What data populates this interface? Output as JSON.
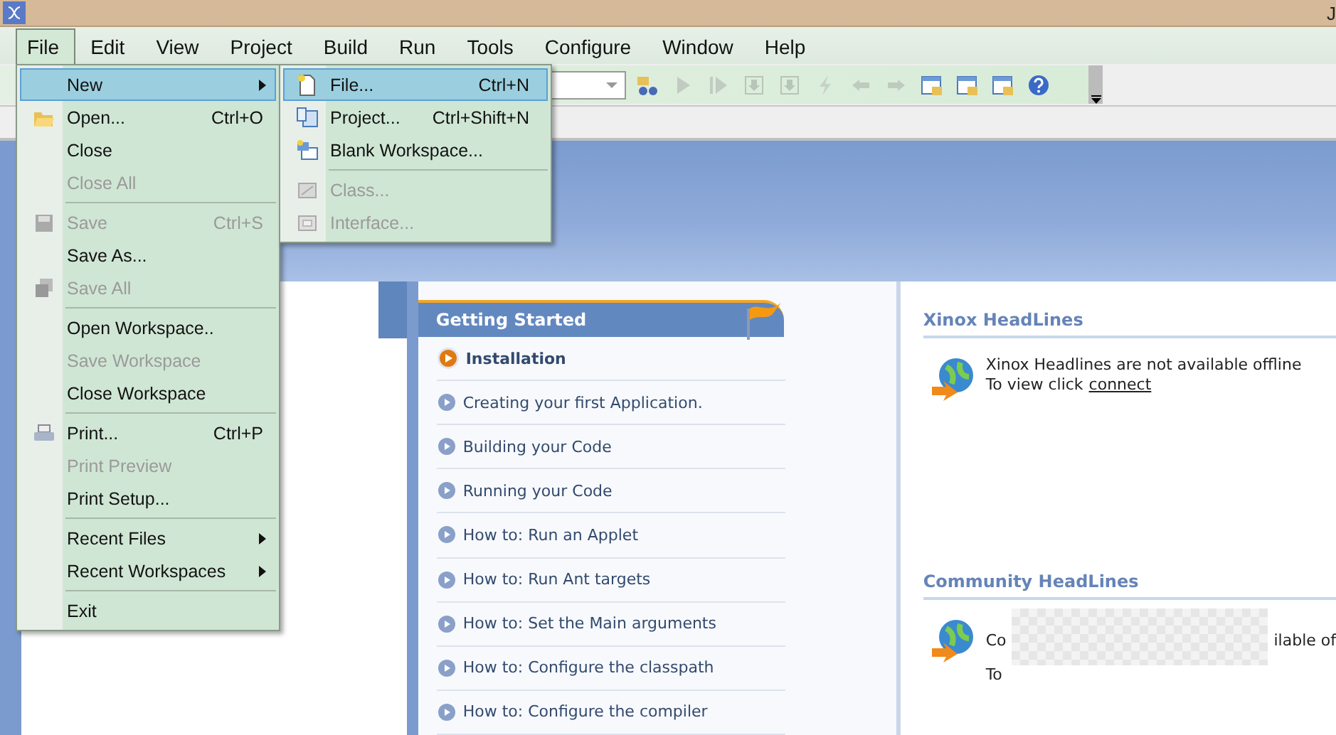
{
  "window": {
    "title": "J"
  },
  "menubar": [
    {
      "label": "File",
      "selected": true
    },
    {
      "label": "Edit",
      "selected": false
    },
    {
      "label": "View",
      "selected": false
    },
    {
      "label": "Project",
      "selected": false
    },
    {
      "label": "Build",
      "selected": false
    },
    {
      "label": "Run",
      "selected": false
    },
    {
      "label": "Tools",
      "selected": false
    },
    {
      "label": "Configure",
      "selected": false
    },
    {
      "label": "Window",
      "selected": false
    },
    {
      "label": "Help",
      "selected": false
    }
  ],
  "toolbar": [
    {
      "kind": "find",
      "disabled": false
    },
    {
      "kind": "run",
      "disabled": true
    },
    {
      "kind": "step",
      "disabled": true
    },
    {
      "kind": "down",
      "disabled": true
    },
    {
      "kind": "down",
      "disabled": true
    },
    {
      "kind": "bolt",
      "disabled": true
    },
    {
      "kind": "back",
      "disabled": true
    },
    {
      "kind": "forward",
      "disabled": true
    },
    {
      "kind": "window",
      "disabled": false
    },
    {
      "kind": "window",
      "disabled": false
    },
    {
      "kind": "window",
      "disabled": false
    },
    {
      "kind": "help",
      "disabled": false
    }
  ],
  "file_menu": [
    {
      "kind": "item",
      "label": "New",
      "disabled": false,
      "selected": true,
      "submenu": true
    },
    {
      "kind": "item",
      "label": "Open...",
      "shortcut": "Ctrl+O",
      "disabled": false,
      "selected": false,
      "submenu": false
    },
    {
      "kind": "item",
      "label": "Close",
      "disabled": false,
      "selected": false,
      "submenu": false
    },
    {
      "kind": "item",
      "label": "Close All",
      "disabled": true,
      "selected": false,
      "submenu": false
    },
    {
      "kind": "separator"
    },
    {
      "kind": "item",
      "label": "Save",
      "shortcut": "Ctrl+S",
      "disabled": true,
      "selected": false,
      "submenu": false
    },
    {
      "kind": "item",
      "label": "Save As...",
      "disabled": false,
      "selected": false,
      "submenu": false
    },
    {
      "kind": "item",
      "label": "Save All",
      "disabled": true,
      "selected": false,
      "submenu": false
    },
    {
      "kind": "separator"
    },
    {
      "kind": "item",
      "label": "Open Workspace..",
      "disabled": false,
      "selected": false,
      "submenu": false
    },
    {
      "kind": "item",
      "label": "Save Workspace",
      "disabled": true,
      "selected": false,
      "submenu": false
    },
    {
      "kind": "item",
      "label": "Close Workspace",
      "disabled": false,
      "selected": false,
      "submenu": false
    },
    {
      "kind": "separator"
    },
    {
      "kind": "item",
      "label": "Print...",
      "shortcut": "Ctrl+P",
      "disabled": false,
      "selected": false,
      "submenu": false
    },
    {
      "kind": "item",
      "label": "Print Preview",
      "disabled": true,
      "selected": false,
      "submenu": false
    },
    {
      "kind": "item",
      "label": "Print Setup...",
      "disabled": false,
      "selected": false,
      "submenu": false
    },
    {
      "kind": "separator"
    },
    {
      "kind": "item",
      "label": "Recent Files",
      "disabled": false,
      "selected": false,
      "submenu": true
    },
    {
      "kind": "item",
      "label": "Recent Workspaces",
      "disabled": false,
      "selected": false,
      "submenu": true
    },
    {
      "kind": "separator"
    },
    {
      "kind": "item",
      "label": "Exit",
      "disabled": false,
      "selected": false,
      "submenu": false
    }
  ],
  "new_submenu": [
    {
      "kind": "item",
      "label": "File...",
      "shortcut": "Ctrl+N",
      "disabled": false,
      "selected": true
    },
    {
      "kind": "item",
      "label": "Project...",
      "shortcut": "Ctrl+Shift+N",
      "disabled": false,
      "selected": false
    },
    {
      "kind": "item",
      "label": "Blank Workspace...",
      "disabled": false,
      "selected": false
    },
    {
      "kind": "separator"
    },
    {
      "kind": "item",
      "label": "Class...",
      "disabled": true,
      "selected": false
    },
    {
      "kind": "item",
      "label": "Interface...",
      "disabled": true,
      "selected": false
    }
  ],
  "getting_started": {
    "title": "Getting Started",
    "items": [
      {
        "label": "Installation",
        "selected": true
      },
      {
        "label": "Creating your first Application.",
        "selected": false
      },
      {
        "label": "Building your Code",
        "selected": false
      },
      {
        "label": "Running your Code",
        "selected": false
      },
      {
        "label": "How to: Run an Applet",
        "selected": false
      },
      {
        "label": "How to: Run Ant targets",
        "selected": false
      },
      {
        "label": "How to: Set the Main arguments",
        "selected": false
      },
      {
        "label": "How to: Configure the classpath",
        "selected": false
      },
      {
        "label": "How to: Configure the compiler",
        "selected": false
      }
    ]
  },
  "headlines": [
    {
      "title": "Xinox HeadLines",
      "line_1": "Xinox Headlines are not available offline",
      "line_2": "To view click",
      "link": "connect",
      "obscured": false
    },
    {
      "title": "Community HeadLines",
      "line_1": "Co",
      "line_1_end": "ilable of",
      "line_2": "To",
      "obscured": true
    }
  ]
}
